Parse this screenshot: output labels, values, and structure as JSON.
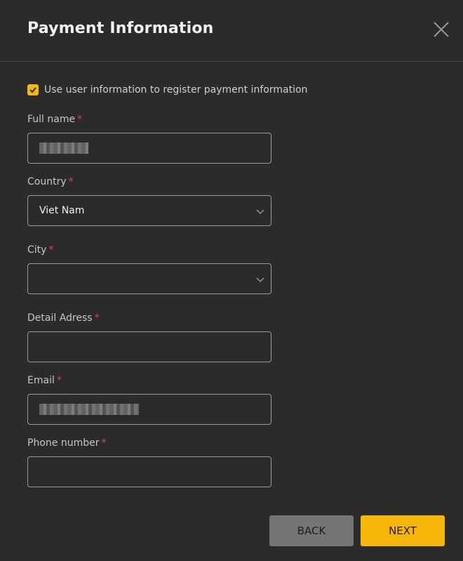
{
  "dialog": {
    "title": "Payment Information"
  },
  "checkbox": {
    "label": "Use user information to register payment information",
    "checked": true,
    "color": "#f5b80b"
  },
  "fields": {
    "full_name": {
      "label": "Full name",
      "required_mark": "*"
    },
    "country": {
      "label": "Country",
      "required_mark": "*",
      "value": "Viet Nam"
    },
    "city": {
      "label": "City",
      "required_mark": "*",
      "value": ""
    },
    "detail_address": {
      "label": "Detail Adress",
      "required_mark": "*",
      "value": ""
    },
    "email": {
      "label": "Email",
      "required_mark": "*"
    },
    "phone": {
      "label": "Phone number",
      "required_mark": "*",
      "value": ""
    }
  },
  "buttons": {
    "back_label": "BACK",
    "next_label": "NEXT",
    "accent": "#f7b708"
  }
}
